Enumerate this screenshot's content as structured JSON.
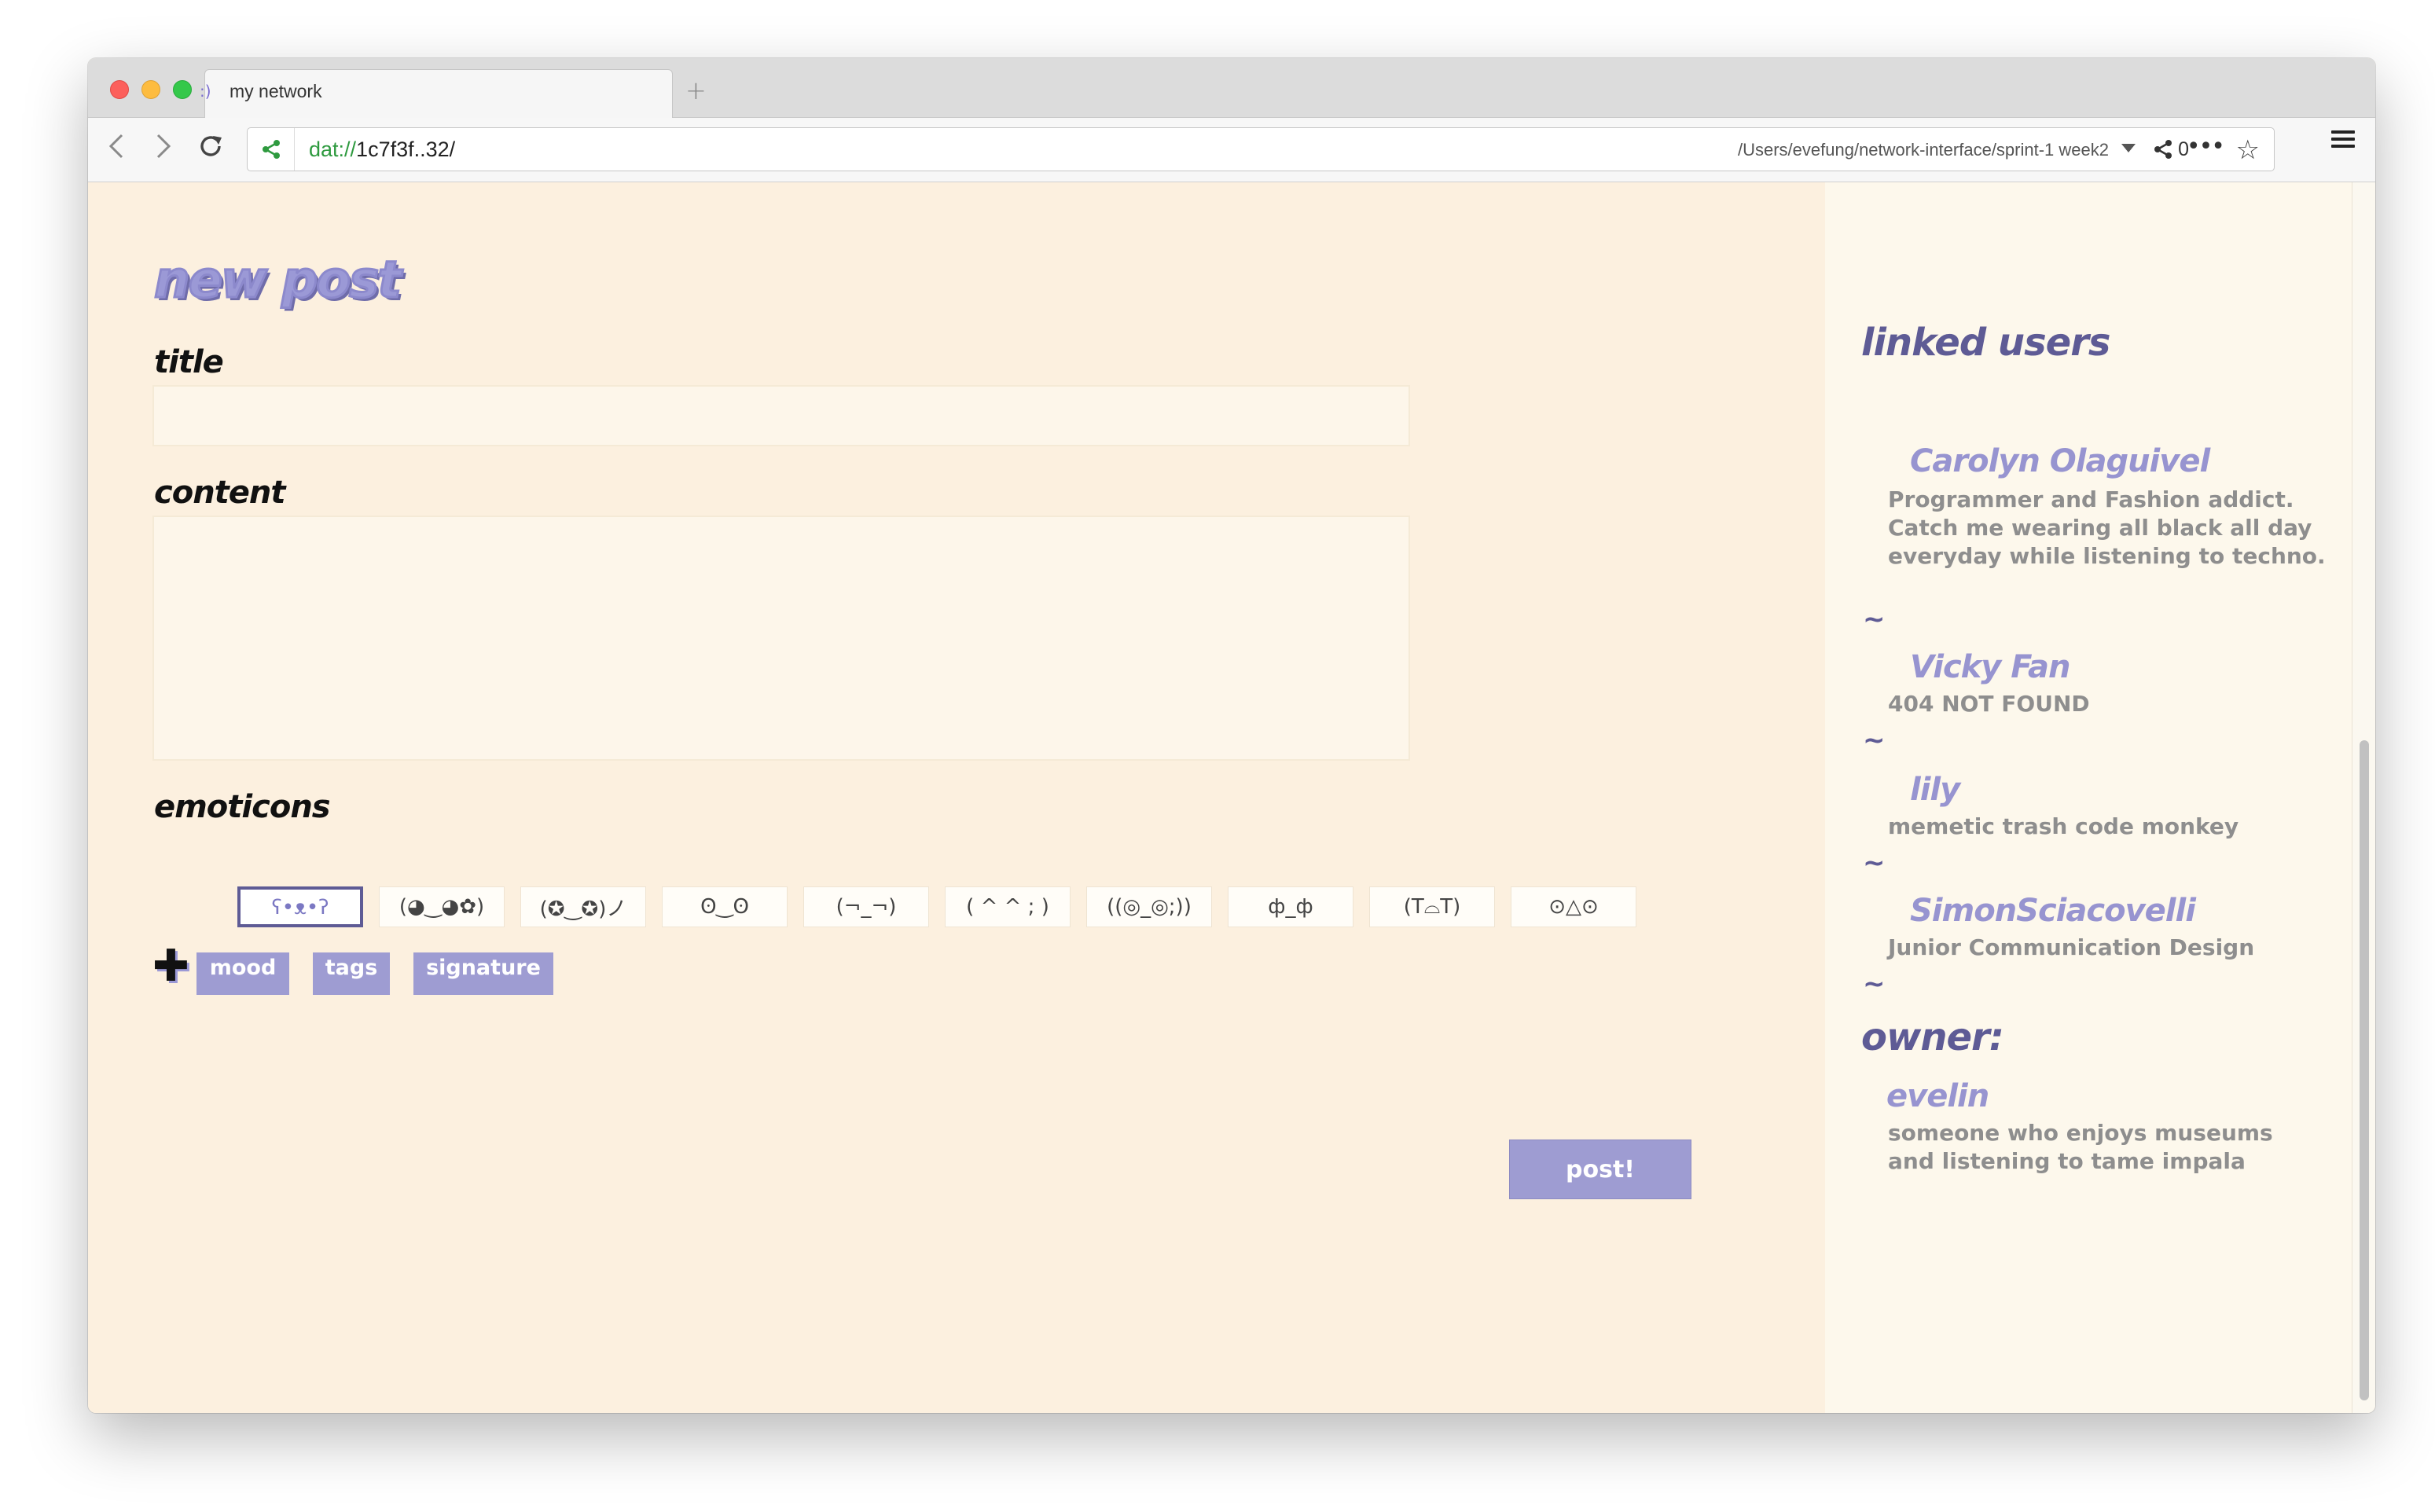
{
  "browser": {
    "tab_favicon": ":)",
    "tab_title": "my network",
    "new_tab": "+",
    "url_scheme": "dat://",
    "url_host": "1c7f3f..32/",
    "url_path": "/Users/evefung/network-interface/sprint-1 week2",
    "peer_count": "0",
    "more": "•••",
    "star": "☆"
  },
  "form": {
    "page_title": "new post",
    "title_label": "title",
    "title_value": "",
    "content_label": "content",
    "content_value": "",
    "emoticons_label": "emoticons",
    "emoticons": [
      "ʕ•ᴥ•ʔ",
      "(◕‿◕✿)",
      "(✪‿✪)ノ",
      "ʘ‿ʘ",
      "(¬_¬)",
      "( ^ ^ ; )",
      "((◎_◎;))",
      "ф_ф",
      "(T⌓T)",
      "⊙△⊙"
    ],
    "selected_emoticon": 0,
    "add_symbol": "✚",
    "extras": [
      "mood",
      "tags",
      "signature"
    ],
    "post_button": "post!"
  },
  "sidebar": {
    "linked_heading": "linked users",
    "users": [
      {
        "name": "Carolyn Olaguivel",
        "bio": "Programmer and Fashion addict. Catch me wearing all black all day everyday while listening to techno."
      },
      {
        "name": "Vicky Fan",
        "bio": "404 NOT FOUND"
      },
      {
        "name": "lily",
        "bio": "memetic trash code monkey"
      },
      {
        "name": "SimonSciacovelli",
        "bio": "Junior Communication Design"
      }
    ],
    "separator": "~",
    "owner_heading": "owner:",
    "owner": {
      "name": "evelin",
      "bio": "someone who enjoys museums and listening to tame impala"
    }
  },
  "colors": {
    "page_bg": "#fcf0df",
    "accent": "#9e9cd2",
    "accent_dark": "#5e5b95",
    "bio_gray": "#8e8e8e"
  }
}
